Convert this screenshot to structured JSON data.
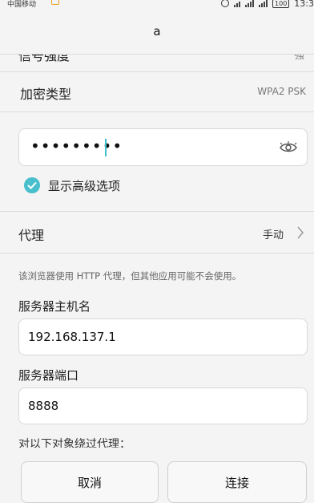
{
  "status": {
    "carrier": "中国移动",
    "battery": "100",
    "time": "13:3"
  },
  "header": {
    "title": "a"
  },
  "signal_row": {
    "label": "信号强度",
    "value": "强"
  },
  "encryption": {
    "label": "加密类型",
    "value": "WPA2 PSK"
  },
  "password": {
    "masked_value": "•••••••••"
  },
  "advanced": {
    "label": "显示高级选项",
    "checked": true
  },
  "proxy": {
    "label": "代理",
    "value": "手动"
  },
  "proxy_note": "该浏览器使用 HTTP 代理，但其他应用可能不会使用。",
  "host": {
    "label": "服务器主机名",
    "value": "192.168.137.1"
  },
  "port": {
    "label": "服务器端口",
    "value": "8888"
  },
  "bypass": {
    "label": "对以下对象绕过代理："
  },
  "actions": {
    "cancel": "取消",
    "connect": "连接"
  },
  "colors": {
    "accent": "#47bfcc",
    "background": "#f4f4f4"
  }
}
